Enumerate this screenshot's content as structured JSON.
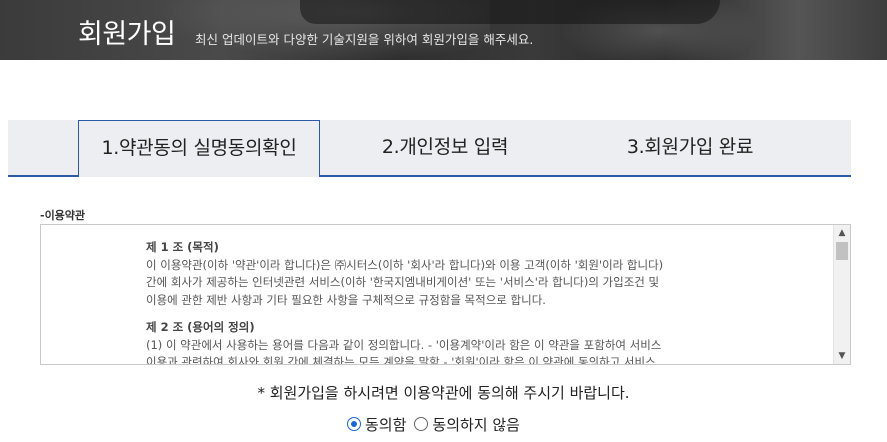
{
  "banner": {
    "title": "회원가입",
    "subtitle": "최신 업데이트와 다양한 기술지원을 위하여 회원가입을 해주세요."
  },
  "steps": [
    {
      "label": "1.약관동의 실명동의확인",
      "active": true
    },
    {
      "label": "2.개인정보 입력",
      "active": false
    },
    {
      "label": "3.회원가입 완료",
      "active": false
    }
  ],
  "terms": {
    "section_label": "-이용약관",
    "article1_title": "제 1 조 (목적)",
    "article1_lines": [
      "이 이용약관(이하 '약관'이라 합니다)은 ㈜시터스(이하 '회사'라 합니다)와 이용 고객(이하 '회원'이라 합니다)",
      "간에 회사가 제공하는 인터넷관련 서비스(이하 '한국지엠내비게이션' 또는 '서비스'라 합니다)의 가입조건 및",
      "이용에 관한 제반 사항과 기타 필요한 사항을 구체적으로 규정함을 목적으로 합니다."
    ],
    "article2_title": "제 2 조 (용어의 정의)",
    "article2_lines": [
      "(1) 이 약관에서 사용하는 용어를 다음과 같이 정의합니다. - '이용계약'이라 함은 이 약관을 포함하여 서비스",
      "이용과 관련하여 회사와 회원 간에 체결하는 모든 계약을 말함 - '회원'이라 함은 이 약관에 동의하고 서비스"
    ],
    "scroll_up_icon": "▲",
    "scroll_down_icon": "▼"
  },
  "notice": "* 회원가입을 하시려면 이용약관에 동의해 주시기 바랍니다.",
  "consent": {
    "agree_label": "동의함",
    "disagree_label": "동의하지 않음",
    "selected": "agree"
  }
}
